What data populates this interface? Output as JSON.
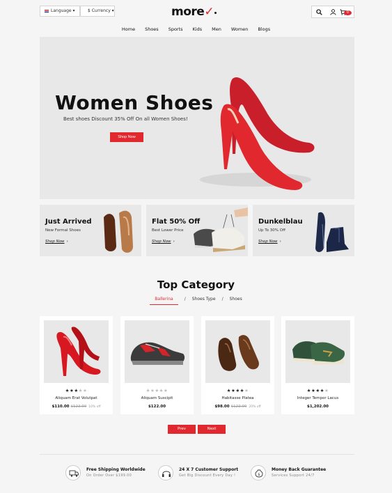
{
  "header": {
    "language_label": "Language",
    "currency_label": "$ Currency",
    "logo_text": "more",
    "cart_count": "0"
  },
  "nav": [
    "Home",
    "Shoes",
    "Sports",
    "Kids",
    "Men",
    "Women",
    "Blogs"
  ],
  "hero": {
    "title": "Women Shoes",
    "subtitle": "Best shoes Discount 35% Off On all Women Shoes!",
    "button": "Shop Now"
  },
  "banners": [
    {
      "title": "Just Arrived",
      "subtitle": "New Formal Shoes",
      "link": "Shop Now"
    },
    {
      "title": "Flat 50% Off",
      "subtitle": "Best Lower Price",
      "link": "Shop Now"
    },
    {
      "title": "Dunkelblau",
      "subtitle": "Up To 30% Off",
      "link": "Shop Now"
    }
  ],
  "category": {
    "title": "Top Category",
    "tabs": [
      "Ballerina",
      "Shoes Type",
      "Shoes"
    ]
  },
  "products": [
    {
      "name": "Aliquam Erat Volutpat",
      "price": "$110.00",
      "old_price": "$122.00",
      "discount": "10% off",
      "rating": 3
    },
    {
      "name": "Aliquam Suscipit",
      "price": "$122.00",
      "old_price": "",
      "discount": "",
      "rating": 0
    },
    {
      "name": "Habitasse Platea",
      "price": "$98.00",
      "old_price": "$122.00",
      "discount": "20% off",
      "rating": 4
    },
    {
      "name": "Integer Tempor Lacus",
      "price": "$1,202.00",
      "old_price": "",
      "discount": "",
      "rating": 4
    }
  ],
  "pagination": {
    "prev": "Prev",
    "next": "Next"
  },
  "features": [
    {
      "title": "Free Shipping Worldwide",
      "subtitle": "On Order Over $199.00",
      "icon": "truck-icon"
    },
    {
      "title": "24 X 7 Customer Support",
      "subtitle": "Get Big Discount Every Day !",
      "icon": "headset-icon"
    },
    {
      "title": "Money Back Guarantee",
      "subtitle": "Services Support 24/7",
      "icon": "money-bag-icon"
    }
  ],
  "colors": {
    "accent": "#e0282e",
    "panel": "#e8e8e8"
  }
}
